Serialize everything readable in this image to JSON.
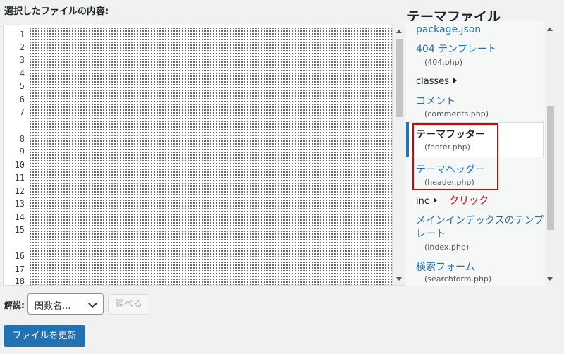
{
  "selected_file_label": "選択したファイルの内容:",
  "theme_files_title": "テーマファイル",
  "editor": {
    "line_numbers": [
      "1",
      "2",
      "3",
      "4",
      "5",
      "6",
      "7",
      "8",
      "9",
      "10",
      "11",
      "12",
      "13",
      "14",
      "15",
      "16",
      "17",
      "18"
    ]
  },
  "files": {
    "package": "package.json",
    "template404": {
      "label": "404 テンプレート",
      "file": "(404.php)"
    },
    "classes_folder": "classes",
    "comments": {
      "label": "コメント",
      "file": "(comments.php)"
    },
    "footer": {
      "label": "テーマフッター",
      "file": "(footer.php)"
    },
    "header": {
      "label": "テーマヘッダー",
      "file": "(header.php)"
    },
    "inc_folder": "inc",
    "index": {
      "label_line1": "メインインデックスのテンプ",
      "label_line2": "レート",
      "file": "(index.php)"
    },
    "searchform": {
      "label": "検索フォーム",
      "file": "(searchform.php)"
    }
  },
  "annotation": {
    "click_note": "クリック",
    "color": "#e00000"
  },
  "documentation": {
    "label": "解説:",
    "select_value": "関数名...",
    "lookup_button": "調べる"
  },
  "update_button": "ファイルを更新",
  "colors": {
    "link": "#2271b1",
    "primary_button": "#2271b1",
    "background": "#f1f1f1"
  }
}
